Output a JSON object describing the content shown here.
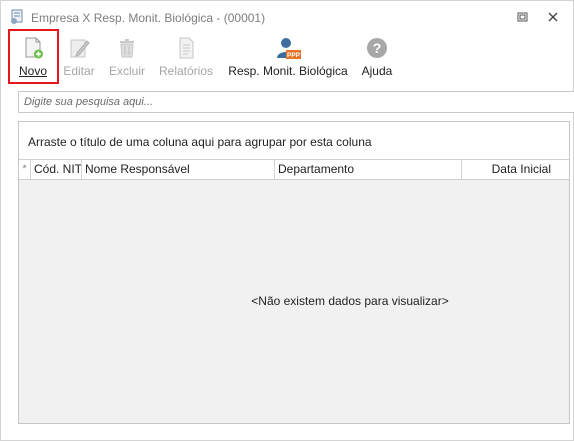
{
  "window": {
    "title": "Empresa X Resp. Monit. Biológica - (00001)"
  },
  "toolbar": {
    "novo": "Novo",
    "editar": "Editar",
    "excluir": "Excluir",
    "relatorios": "Relatórios",
    "resp": "Resp. Monit. Biológica",
    "ajuda": "Ajuda",
    "ppp_badge": "PPP"
  },
  "search": {
    "placeholder": "Digite sua pesquisa aqui..."
  },
  "grid": {
    "group_hint": "Arraste o título de uma coluna aqui para agrupar por esta coluna",
    "indicator": "*",
    "columns": [
      "Cód. NIT",
      "Nome Responsável",
      "Departamento",
      "Data Inicial"
    ],
    "empty_message": "<Não existem dados para visualizar>"
  },
  "colors": {
    "highlight": "#e8141e",
    "disabled_text": "#a5a5a5",
    "ppp_orange": "#e8742a"
  }
}
